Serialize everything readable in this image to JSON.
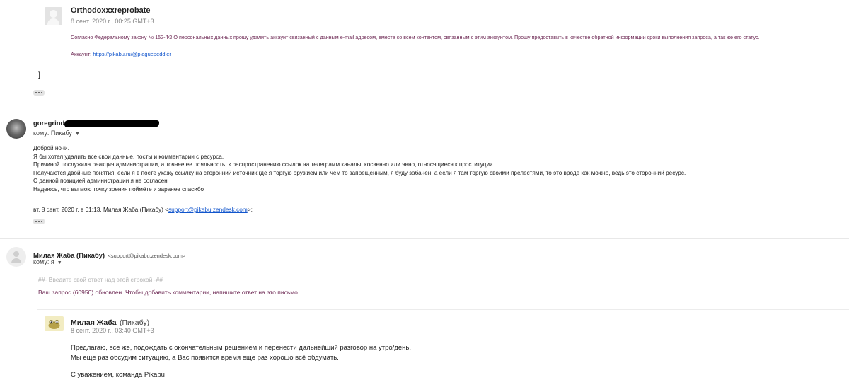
{
  "thread1": {
    "sender": "Orthodoxxxreprobate",
    "date": "8 сент. 2020 г., 00:25 GMT+3",
    "body": "Согласно Федеральному закону № 152-ФЗ О персональных данных прошу удалить аккаунт связанный с данным e-mail адресом, вместе со всем контентом, связанным с этим аккаунтом. Прошу предоставить в качестве обратной информации сроки выполнения запроса, а так же его статус.",
    "account_label": "Аккаунт:",
    "account_link": "https://pikabu.ru/@plaguepeddler",
    "bracket": "]"
  },
  "message2": {
    "sender": "goregrind",
    "to_label": "кому: Пикабу",
    "lines": [
      "Доброй ночи.",
      "Я бы хотел удалить все свои данные, посты и комментарии с ресурса.",
      "Причиной послужила реакция администрации, а точнее ее лояльность, к распространению ссылок на телеграмм каналы, косвенно или явно, относящиеся к проституции.",
      "Получаются двойные понятия, если я в посте укажу ссылку на сторонний источник где я торгую оружием или чем то запрещённым, я буду забанен, а если я там торгую своими прелестями, то это вроде как можно, ведь это сторонний ресурс.",
      "С данной позицией администрации я не согласен",
      "Надеюсь, что вы мою точку зрения поймёте и заранее спасибо"
    ],
    "quote_prefix": "вт, 8 сент. 2020 г. в 01:13, Милая Жаба (Пикабу) <",
    "quote_email": "support@pikabu.zendesk.com",
    "quote_suffix": ">:"
  },
  "message3": {
    "sender": "Милая Жаба (Пикабу)",
    "email": "<support@pikabu.zendesk.com>",
    "to_label": "кому: я",
    "reply_marker": "##- Введите свой ответ над этой строкой -##",
    "status": "Ваш запрос (60950) обновлен. Чтобы добавить комментарии, напишите ответ на это письмо.",
    "inner": {
      "name": "Милая Жаба",
      "org": "(Пикабу)",
      "date": "8 сент. 2020 г., 03:40 GMT+3",
      "line1": "Предлагаю, все же, подождать с окончательным решением и перенести дальнейший разговор на утро/день.",
      "line2": "Мы еще раз обсудим ситуацию, а Вас появится время еще раз хорошо всё обдумать.",
      "line3": "С уважением, команда Pikabu"
    }
  },
  "icons": {
    "avatar_placeholder": "person-icon",
    "more": "ellipsis-icon",
    "chevron": "chevron-down-icon"
  }
}
